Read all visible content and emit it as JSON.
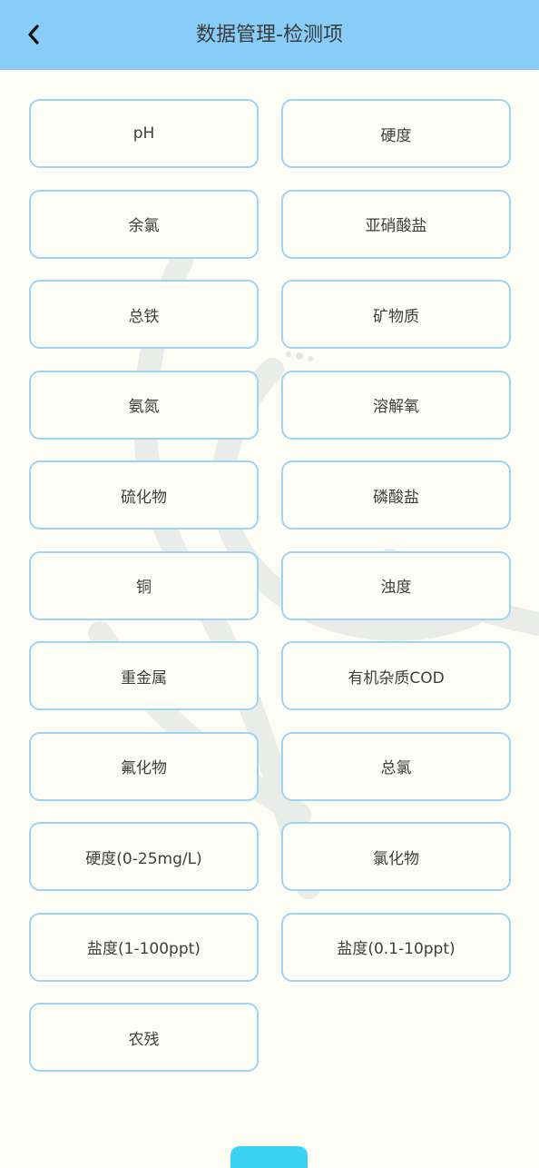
{
  "header": {
    "title": "数据管理-检测项",
    "back_icon": "chevron-left-icon"
  },
  "colors": {
    "header_bg": "#88cdf8",
    "item_border": "#9fd3f2",
    "page_bg": "#fdfdf6",
    "bottom_tab": "#3cd2f5"
  },
  "items": [
    {
      "label": "pH"
    },
    {
      "label": "硬度"
    },
    {
      "label": "余氯"
    },
    {
      "label": "亚硝酸盐"
    },
    {
      "label": "总铁"
    },
    {
      "label": "矿物质"
    },
    {
      "label": "氨氮"
    },
    {
      "label": "溶解氧"
    },
    {
      "label": "硫化物"
    },
    {
      "label": "磷酸盐"
    },
    {
      "label": "铜"
    },
    {
      "label": "浊度"
    },
    {
      "label": "重金属"
    },
    {
      "label": "有机杂质COD"
    },
    {
      "label": "氟化物"
    },
    {
      "label": "总氯"
    },
    {
      "label": "硬度(0-25mg/L)"
    },
    {
      "label": "氯化物"
    },
    {
      "label": "盐度(1-100ppt)"
    },
    {
      "label": "盐度(0.1-10ppt)"
    },
    {
      "label": "农残"
    }
  ]
}
